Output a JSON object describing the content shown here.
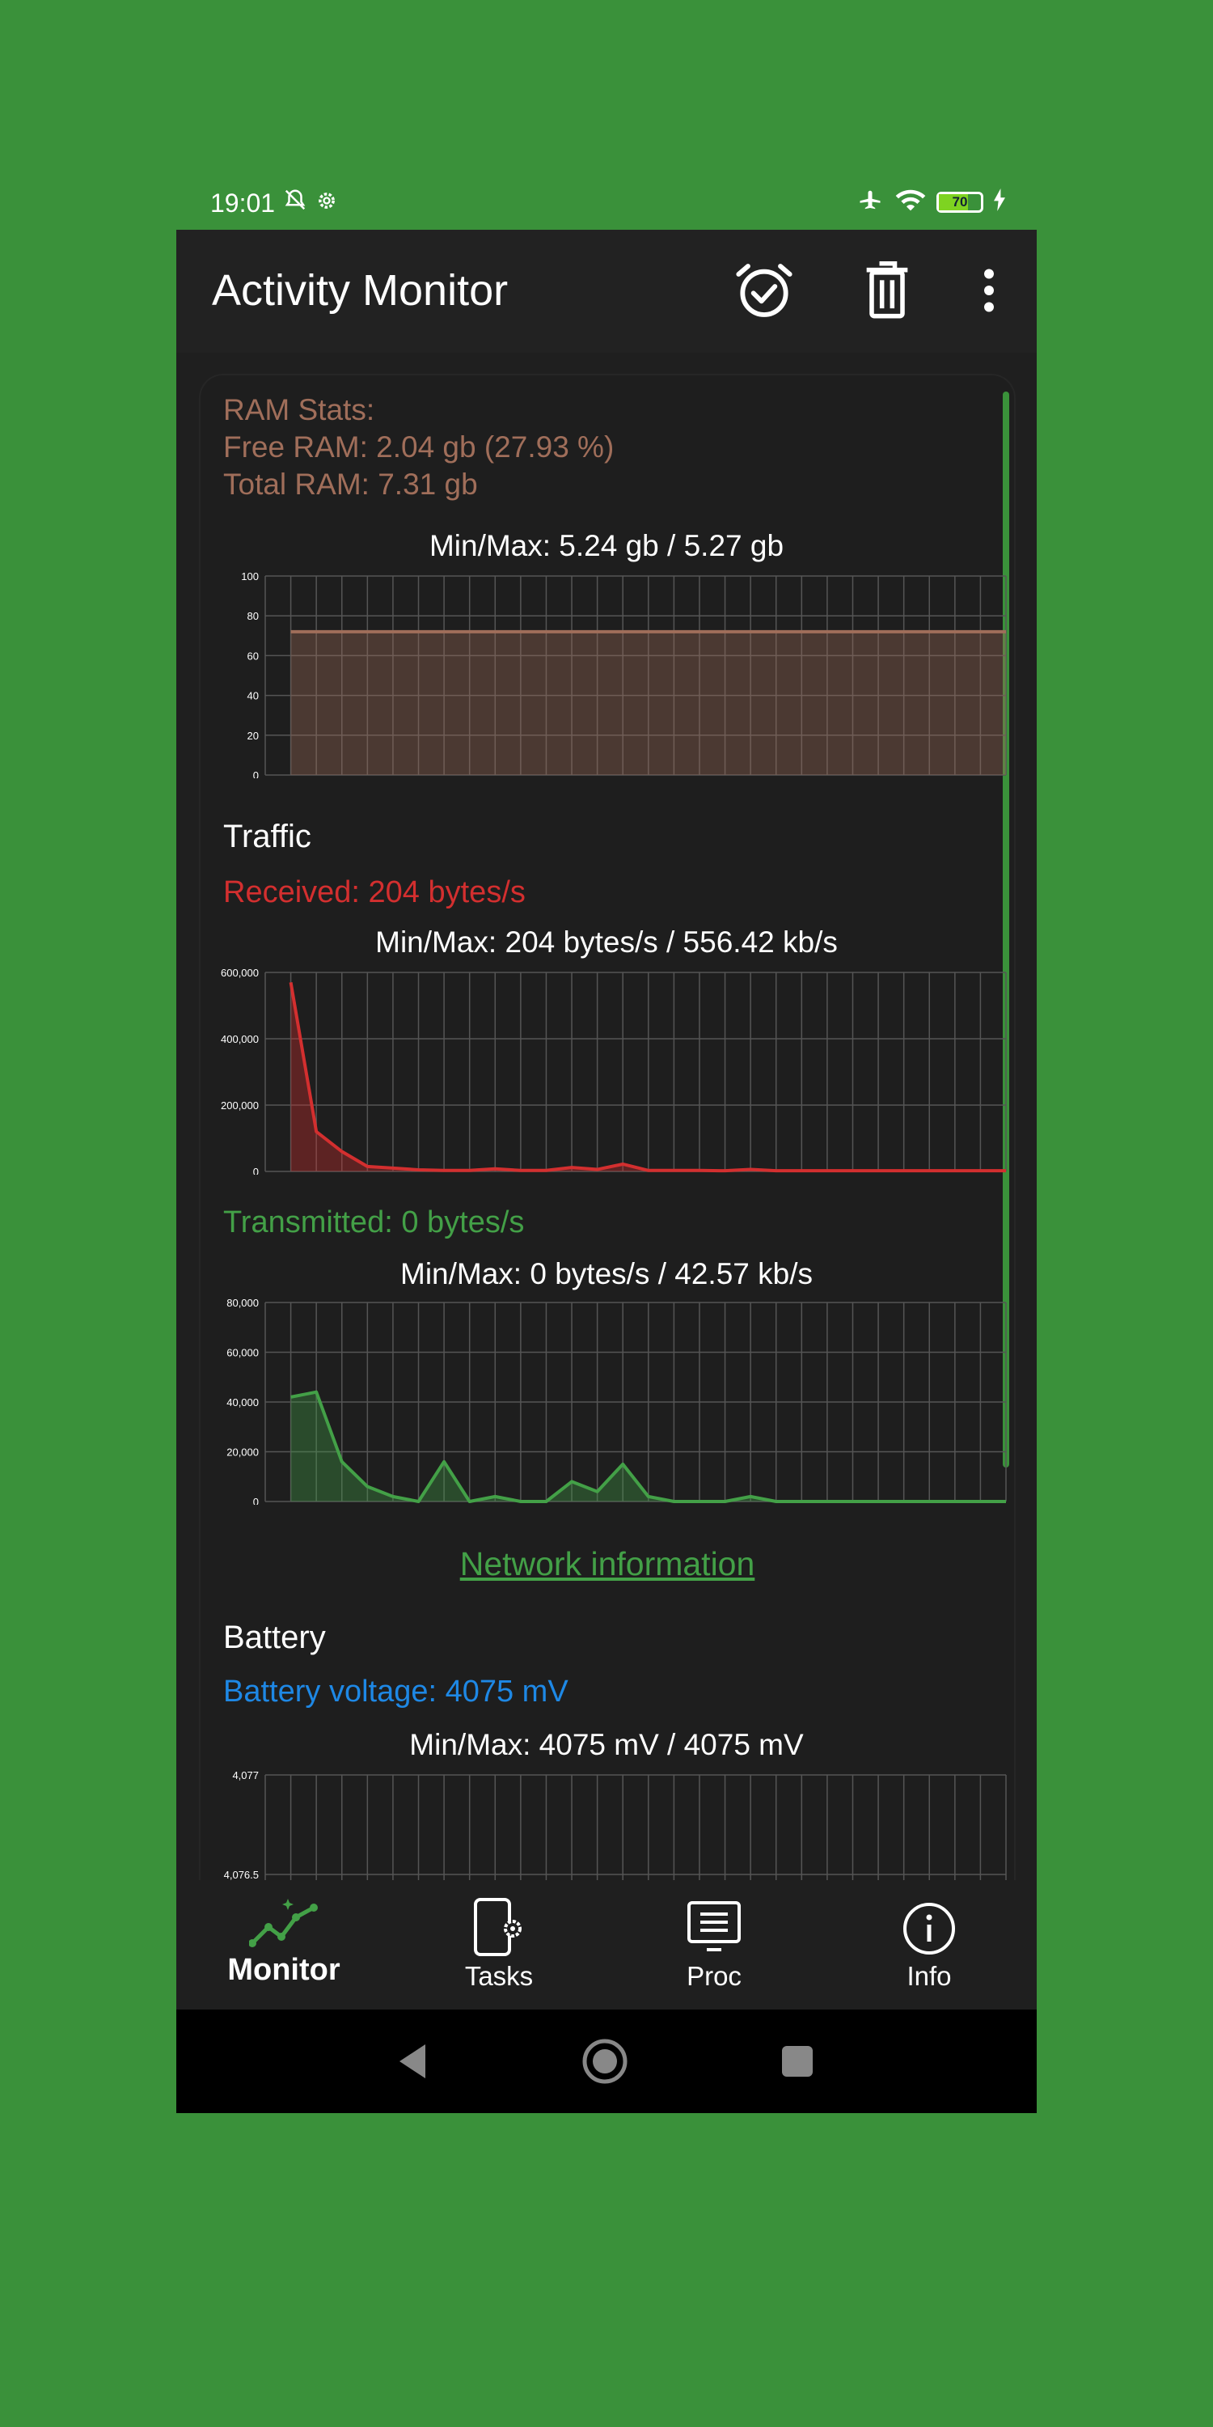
{
  "status_bar": {
    "time": "19:01",
    "battery": "70"
  },
  "app_bar": {
    "title": "Activity Monitor"
  },
  "ram": {
    "title": "RAM Stats:",
    "free": "Free RAM: 2.04 gb (27.93 %)",
    "total": "Total RAM: 7.31 gb",
    "minmax": "Min/Max: 5.24 gb / 5.27 gb"
  },
  "traffic": {
    "title": "Traffic",
    "received": "Received: 204 bytes/s",
    "received_minmax": "Min/Max: 204 bytes/s / 556.42 kb/s",
    "transmitted": "Transmitted: 0 bytes/s",
    "transmitted_minmax": "Min/Max: 0 bytes/s / 42.57 kb/s",
    "network_link": "Network information"
  },
  "battery": {
    "title": "Battery",
    "voltage": "Battery voltage: 4075 mV",
    "minmax": "Min/Max: 4075 mV / 4075 mV"
  },
  "bottom_nav": [
    {
      "label": "Monitor",
      "icon": "chart-line-icon",
      "active": true
    },
    {
      "label": "Tasks",
      "icon": "phone-settings-icon",
      "active": false
    },
    {
      "label": "Proc",
      "icon": "list-monitor-icon",
      "active": false
    },
    {
      "label": "Info",
      "icon": "info-icon",
      "active": false
    }
  ],
  "colors": {
    "ram": "#a06e5a",
    "received": "#d32f2f",
    "transmitted": "#43a047",
    "battery": "#1e88e5",
    "accent": "#3a913a"
  },
  "chart_data": [
    {
      "type": "area",
      "name": "ram-chart",
      "ylim": [
        0,
        100
      ],
      "yticks": [
        "100",
        "80",
        "60",
        "40",
        "20",
        "0"
      ],
      "x": [
        1,
        29
      ],
      "values": [
        72,
        72
      ]
    },
    {
      "type": "area",
      "name": "received-chart",
      "ylim": [
        0,
        600000
      ],
      "yticks": [
        "600,000",
        "400,000",
        "200,000",
        "0"
      ],
      "values": [
        570000,
        120000,
        60000,
        15000,
        10000,
        5000,
        3000,
        3000,
        8000,
        3000,
        3000,
        12000,
        6000,
        22000,
        3000,
        3000,
        3000,
        2000,
        6000,
        2000,
        2000,
        2000,
        2000,
        2000,
        2000,
        2000,
        2000,
        2000,
        2000
      ]
    },
    {
      "type": "area",
      "name": "transmitted-chart",
      "ylim": [
        0,
        80000
      ],
      "yticks": [
        "80,000",
        "60,000",
        "40,000",
        "20,000",
        "0"
      ],
      "values": [
        42000,
        44000,
        16000,
        6000,
        2000,
        0,
        16000,
        0,
        2000,
        0,
        0,
        8000,
        4000,
        15000,
        2000,
        0,
        0,
        0,
        2000,
        0,
        0,
        0,
        0,
        0,
        0,
        0,
        0,
        0,
        0
      ]
    },
    {
      "type": "line",
      "name": "battery-chart",
      "ylim": [
        4076,
        4077
      ],
      "yticks": [
        "4,077",
        "4,076.5"
      ],
      "values": []
    }
  ]
}
